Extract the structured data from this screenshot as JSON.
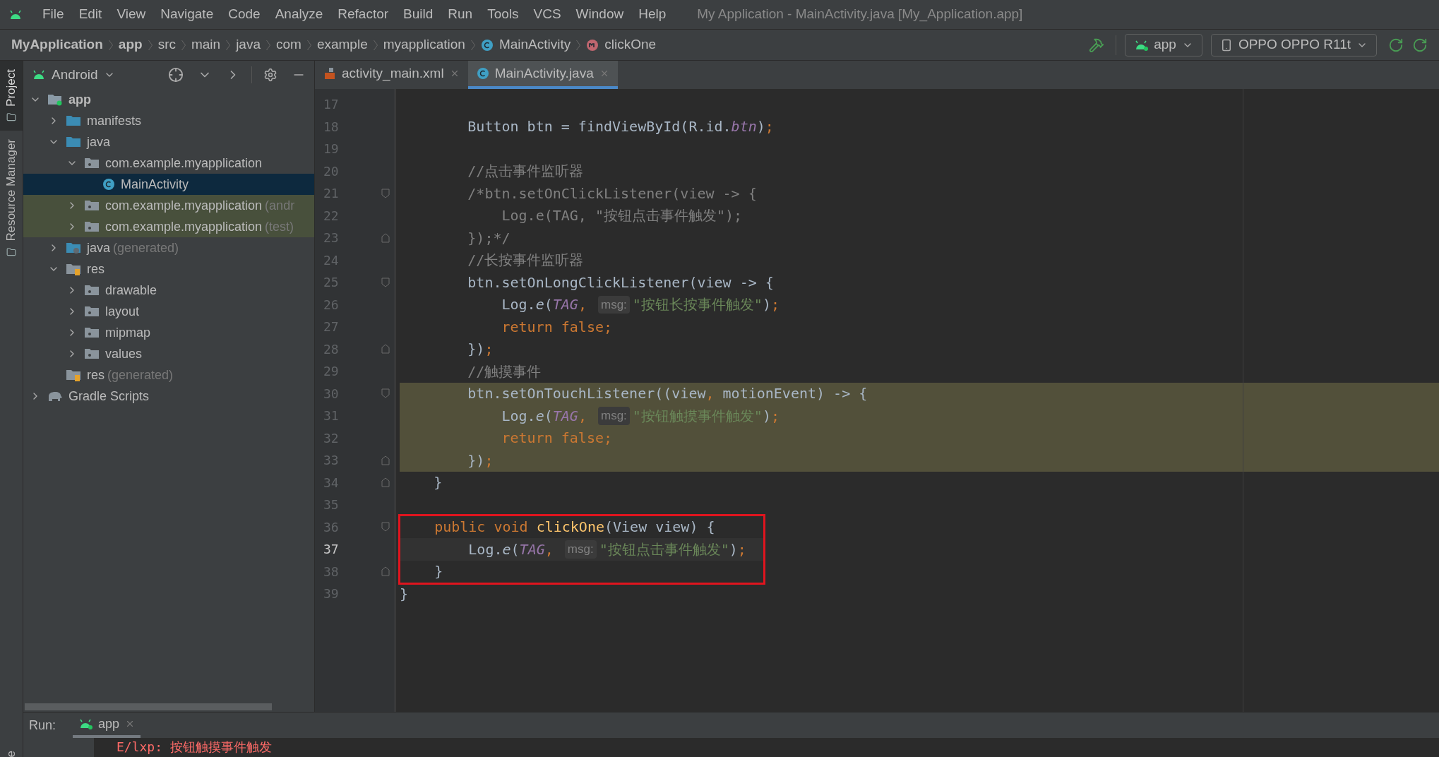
{
  "menu": [
    "File",
    "Edit",
    "View",
    "Navigate",
    "Code",
    "Analyze",
    "Refactor",
    "Build",
    "Run",
    "Tools",
    "VCS",
    "Window",
    "Help"
  ],
  "window": {
    "title": "My Application - MainActivity.java [My_Application.app]"
  },
  "breadcrumbs": [
    {
      "kind": "bold",
      "text": "MyApplication"
    },
    {
      "kind": "bold",
      "text": "app"
    },
    {
      "kind": "plain",
      "text": "src"
    },
    {
      "kind": "plain",
      "text": "main"
    },
    {
      "kind": "plain",
      "text": "java"
    },
    {
      "kind": "plain",
      "text": "com"
    },
    {
      "kind": "plain",
      "text": "example"
    },
    {
      "kind": "plain",
      "text": "myapplication"
    },
    {
      "kind": "class",
      "text": "MainActivity"
    },
    {
      "kind": "method",
      "text": "clickOne"
    }
  ],
  "run_config": {
    "module": "app",
    "device": "OPPO OPPO R11t"
  },
  "side_stripe": [
    {
      "label": "Project",
      "selected": true
    },
    {
      "label": "Resource Manager",
      "selected": false
    }
  ],
  "side_stripe_bottom": "e",
  "project": {
    "view": "Android",
    "tree": [
      {
        "name": "app",
        "kind": "module",
        "expanded": true,
        "children": [
          {
            "name": "manifests",
            "kind": "folder",
            "expanded": false
          },
          {
            "name": "java",
            "kind": "folder",
            "expanded": true,
            "children": [
              {
                "name": "com.example.myapplication",
                "kind": "package",
                "expanded": true,
                "children": [
                  {
                    "name": "MainActivity",
                    "kind": "class",
                    "selected": true
                  }
                ]
              },
              {
                "name": "com.example.myapplication",
                "suffix": "(andr",
                "kind": "package",
                "expanded": false,
                "tinted": true
              },
              {
                "name": "com.example.myapplication",
                "suffix": "(test)",
                "kind": "package",
                "expanded": false,
                "tinted": true
              }
            ]
          },
          {
            "name": "java",
            "suffix": "(generated)",
            "kind": "generated",
            "expanded": false
          },
          {
            "name": "res",
            "kind": "res",
            "expanded": true,
            "children": [
              {
                "name": "drawable",
                "kind": "package",
                "expanded": false
              },
              {
                "name": "layout",
                "kind": "package",
                "expanded": false
              },
              {
                "name": "mipmap",
                "kind": "package",
                "expanded": false
              },
              {
                "name": "values",
                "kind": "package",
                "expanded": false
              }
            ]
          },
          {
            "name": "res",
            "suffix": "(generated)",
            "kind": "res"
          }
        ]
      },
      {
        "name": "Gradle Scripts",
        "kind": "gradle",
        "expanded": false
      }
    ]
  },
  "tabs": [
    {
      "label": "activity_main.xml",
      "kind": "xml",
      "selected": false
    },
    {
      "label": "MainActivity.java",
      "kind": "class",
      "selected": true
    }
  ],
  "code": [
    {
      "number": "17"
    },
    {
      "number": "18",
      "tokens": [
        {
          "kind": "plain",
          "text": "        Button btn = findViewById(R.id."
        },
        {
          "kind": "field",
          "text": "btn"
        },
        {
          "kind": "plain",
          "text": ")"
        },
        {
          "kind": "keyword",
          "text": ";"
        }
      ]
    },
    {
      "number": "19"
    },
    {
      "number": "20",
      "tokens": [
        {
          "kind": "comment",
          "text": "        //点击事件监听器"
        }
      ]
    },
    {
      "number": "21",
      "kind": "opening",
      "tokens": [
        {
          "kind": "comment",
          "text": "        /*btn.setOnClickListener(view -> {"
        }
      ]
    },
    {
      "number": "22",
      "tokens": [
        {
          "kind": "comment",
          "text": "            Log.e(TAG, \"按钮点击事件触发\");"
        }
      ]
    },
    {
      "number": "23",
      "kind": "closing",
      "tokens": [
        {
          "kind": "comment",
          "text": "        });*/"
        }
      ]
    },
    {
      "number": "24",
      "tokens": [
        {
          "kind": "comment",
          "text": "        //长按事件监听器"
        }
      ]
    },
    {
      "number": "25",
      "kind": "opening",
      "tokens": [
        {
          "kind": "plain",
          "text": "        btn.setOnLongClickListener(view -> {"
        }
      ]
    },
    {
      "number": "26",
      "tokens": [
        {
          "kind": "plain",
          "text": "            Log."
        },
        {
          "kind": "italic",
          "text": "e"
        },
        {
          "kind": "plain",
          "text": "("
        },
        {
          "kind": "field",
          "text": "TAG"
        },
        {
          "kind": "keyword",
          "text": ", "
        },
        {
          "kind": "hint",
          "text": "msg:"
        },
        {
          "kind": "string",
          "text": "\"按钮长按事件触发\""
        },
        {
          "kind": "plain",
          "text": ")"
        },
        {
          "kind": "keyword",
          "text": ";"
        }
      ]
    },
    {
      "number": "27",
      "tokens": [
        {
          "kind": "keyword",
          "text": "            return false;"
        }
      ]
    },
    {
      "number": "28",
      "kind": "closing",
      "tokens": [
        {
          "kind": "plain",
          "text": "        })"
        },
        {
          "kind": "keyword",
          "text": ";"
        }
      ]
    },
    {
      "number": "29",
      "tokens": [
        {
          "kind": "comment",
          "text": "        //触摸事件"
        }
      ]
    },
    {
      "number": "30",
      "kind": "opening",
      "highlighted": true,
      "tokens": [
        {
          "kind": "plain",
          "text": "        btn.setOnTouchListener((view"
        },
        {
          "kind": "keyword",
          "text": ", "
        },
        {
          "kind": "plain",
          "text": "motionEvent) -> {"
        }
      ]
    },
    {
      "number": "31",
      "highlighted": true,
      "tokens": [
        {
          "kind": "plain",
          "text": "            Log."
        },
        {
          "kind": "italic",
          "text": "e"
        },
        {
          "kind": "plain",
          "text": "("
        },
        {
          "kind": "field",
          "text": "TAG"
        },
        {
          "kind": "keyword",
          "text": ", "
        },
        {
          "kind": "hint",
          "text": "msg:"
        },
        {
          "kind": "string",
          "text": "\"按钮触摸事件触发\""
        },
        {
          "kind": "plain",
          "text": ")"
        },
        {
          "kind": "keyword",
          "text": ";"
        }
      ]
    },
    {
      "number": "32",
      "highlighted": true,
      "tokens": [
        {
          "kind": "keyword",
          "text": "            return false;"
        }
      ]
    },
    {
      "number": "33",
      "kind": "closing",
      "highlighted": true,
      "tokens": [
        {
          "kind": "plain",
          "text": "        })"
        },
        {
          "kind": "keyword",
          "text": ";"
        }
      ]
    },
    {
      "number": "34",
      "kind": "closing",
      "tokens": [
        {
          "kind": "plain",
          "text": "    }"
        }
      ]
    },
    {
      "number": "35"
    },
    {
      "number": "36",
      "kind": "opening",
      "boxed": true,
      "tokens": [
        {
          "kind": "keyword",
          "text": "    public void "
        },
        {
          "kind": "declaration",
          "text": "clickOne"
        },
        {
          "kind": "plain",
          "text": "(View view) {"
        }
      ]
    },
    {
      "number": "37",
      "current": true,
      "boxed": true,
      "tokens": [
        {
          "kind": "plain",
          "text": "        Log."
        },
        {
          "kind": "italic",
          "text": "e"
        },
        {
          "kind": "plain",
          "text": "("
        },
        {
          "kind": "field",
          "text": "TAG"
        },
        {
          "kind": "keyword",
          "text": ", "
        },
        {
          "kind": "hint",
          "text": "msg:"
        },
        {
          "kind": "string",
          "text": "\"按钮点击事件触发\""
        },
        {
          "kind": "plain",
          "text": ")"
        },
        {
          "kind": "keyword",
          "text": ";"
        }
      ]
    },
    {
      "number": "38",
      "kind": "closing",
      "boxed": true,
      "tokens": [
        {
          "kind": "plain",
          "text": "    }"
        }
      ]
    },
    {
      "number": "39",
      "tokens": [
        {
          "kind": "plain",
          "text": "}"
        }
      ]
    }
  ],
  "run": {
    "label": "Run:",
    "tab": "app",
    "output": [
      {
        "tag": "E/lxp:",
        "text": "按钮触摸事件触发"
      }
    ]
  }
}
